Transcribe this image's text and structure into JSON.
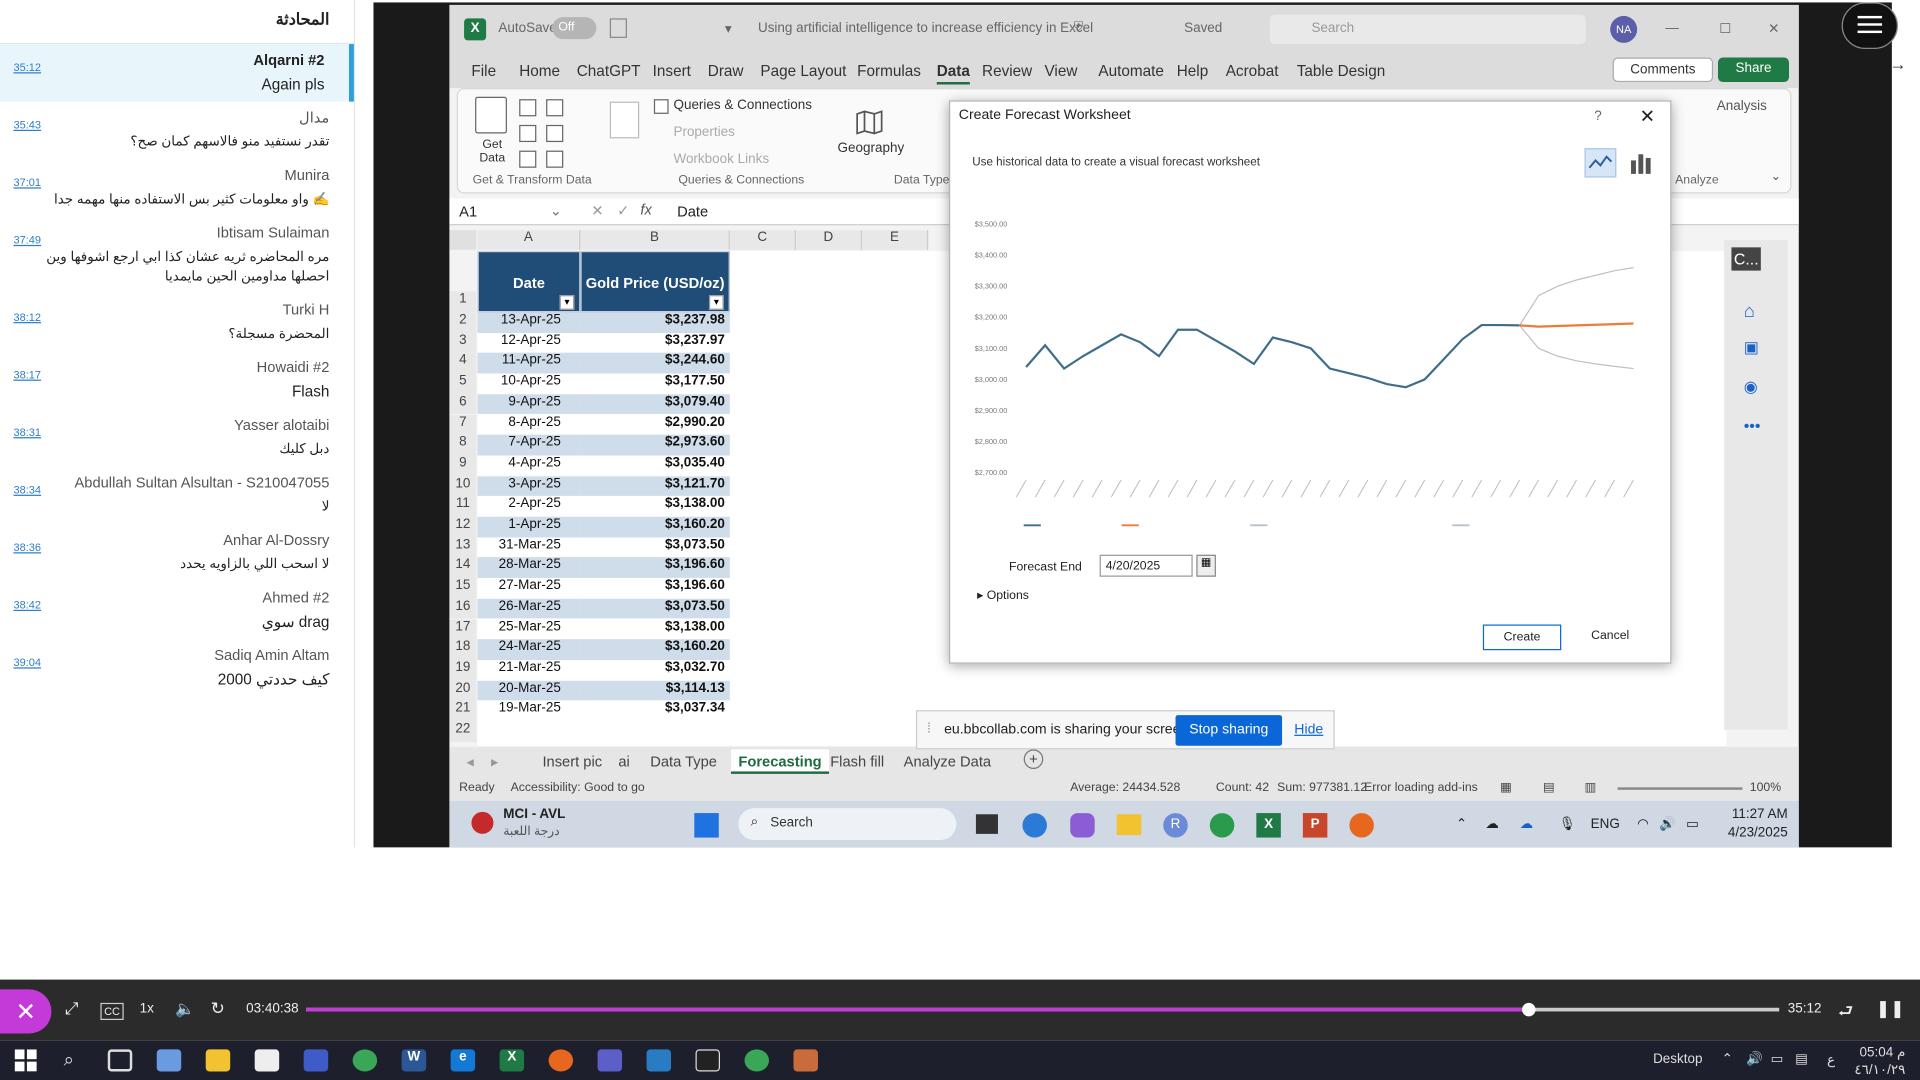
{
  "chat": {
    "title": "المحادثة",
    "messages": [
      {
        "time": "35:12",
        "name": "Alqarni #2",
        "text": "Again pls"
      },
      {
        "time": "35:43",
        "name": "مدال",
        "text": "تقدر نستفيد منو فالاسهم كمان صح؟"
      },
      {
        "time": "37:01",
        "name": "Munira",
        "text": "واو معلومات كثير بس الاستفاده منها مهمه جدا ✍️"
      },
      {
        "time": "37:49",
        "name": "Ibtisam Sulaiman",
        "text": "مره المحاضره ثريه عشان كذا ابي ارجع اشوفها وين احصلها مداومين الحين مايمديا"
      },
      {
        "time": "38:12",
        "name": "Turki H",
        "text": "المحضرة مسجلة؟"
      },
      {
        "time": "38:17",
        "name": "Howaidi #2",
        "text": "Flash"
      },
      {
        "time": "38:31",
        "name": "Yasser alotaibi",
        "text": "دبل كليك"
      },
      {
        "time": "38:34",
        "name": "Abdullah Sultan Alsultan - S210047055",
        "text": "لا"
      },
      {
        "time": "38:36",
        "name": "Anhar Al-Dossry",
        "text": "لا اسحب اللي بالزاويه يحدد"
      },
      {
        "time": "38:42",
        "name": "Ahmed #2",
        "text": "سوي drag"
      },
      {
        "time": "39:04",
        "name": "Sadiq Amin Altam",
        "text": "كيف حددتي 2000"
      }
    ]
  },
  "excel": {
    "title": "Using artificial intelligence to increase efficiency in Excel",
    "autosave": "AutoSave",
    "toggle": "Off",
    "saved": "Saved",
    "search": "Search",
    "user_initials": "NA",
    "menu": [
      "File",
      "Home",
      "ChatGPT",
      "Insert",
      "Draw",
      "Page Layout",
      "Formulas",
      "Data",
      "Review",
      "View",
      "Automate",
      "Help",
      "Acrobat",
      "Table Design"
    ],
    "comments": "Comments",
    "share": "Share",
    "ribbon": {
      "get_data": "Get Data",
      "queries": "Queries & Connections",
      "properties": "Properties",
      "workbook_links": "Workbook Links",
      "geography": "Geography",
      "analysis": "Analysis",
      "group_get": "Get & Transform Data",
      "group_queries": "Queries & Connections",
      "group_types": "Data Types",
      "group_analyze": "Analyze"
    },
    "name_box": "A1",
    "formula": "Date",
    "columns": [
      "A",
      "B",
      "C",
      "D",
      "E"
    ],
    "header_date": "Date",
    "header_price": "Gold Price (USD/oz)",
    "rows": [
      [
        "13-Apr-25",
        "$3,237.98"
      ],
      [
        "12-Apr-25",
        "$3,237.97"
      ],
      [
        "11-Apr-25",
        "$3,244.60"
      ],
      [
        "10-Apr-25",
        "$3,177.50"
      ],
      [
        "9-Apr-25",
        "$3,079.40"
      ],
      [
        "8-Apr-25",
        "$2,990.20"
      ],
      [
        "7-Apr-25",
        "$2,973.60"
      ],
      [
        "4-Apr-25",
        "$3,035.40"
      ],
      [
        "3-Apr-25",
        "$3,121.70"
      ],
      [
        "2-Apr-25",
        "$3,138.00"
      ],
      [
        "1-Apr-25",
        "$3,160.20"
      ],
      [
        "31-Mar-25",
        "$3,073.50"
      ],
      [
        "28-Mar-25",
        "$3,196.60"
      ],
      [
        "27-Mar-25",
        "$3,196.60"
      ],
      [
        "26-Mar-25",
        "$3,073.50"
      ],
      [
        "25-Mar-25",
        "$3,138.00"
      ],
      [
        "24-Mar-25",
        "$3,160.20"
      ],
      [
        "21-Mar-25",
        "$3,032.70"
      ],
      [
        "20-Mar-25",
        "$3,114.13"
      ],
      [
        "19-Mar-25",
        "$3,037.34"
      ]
    ],
    "sheet_tabs": [
      "Insert pic",
      "ai",
      "Data Type",
      "Forecasting",
      "Flash fill",
      "Analyze Data"
    ],
    "active_tab": "Forecasting",
    "status": {
      "ready": "Ready",
      "accessibility": "Accessibility: Good to go",
      "average": "Average: 24434.528",
      "count": "Count: 42",
      "sum": "Sum: 977381.12",
      "addins": "Error loading add-ins",
      "zoom": "100%"
    },
    "side_pane_title": "C..."
  },
  "dialog": {
    "title": "Create Forecast Worksheet",
    "help": "?",
    "subtitle": "Use historical data to create a visual forecast worksheet",
    "forecast_end_label": "Forecast End",
    "forecast_end_value": "4/20/2025",
    "options": "Options",
    "create": "Create",
    "cancel": "Cancel"
  },
  "chart_data": {
    "type": "line",
    "ylim": [
      2700,
      3500
    ],
    "yticks": [
      "$3,500.00",
      "$3,400.00",
      "$3,300.00",
      "$3,200.00",
      "$3,100.00",
      "$3,000.00",
      "$2,900.00",
      "$2,800.00",
      "$2,700.00"
    ],
    "history": [
      3040,
      3110,
      3035,
      3075,
      3110,
      3145,
      3120,
      3075,
      3160,
      3160,
      3125,
      3090,
      3050,
      3135,
      3120,
      3100,
      3035,
      3020,
      3005,
      2985,
      2975,
      3000,
      3065,
      3130,
      3175,
      3175,
      3174
    ],
    "forecast": [
      3174,
      3170,
      3172,
      3174,
      3176,
      3178,
      3180
    ],
    "upper": [
      3174,
      3270,
      3300,
      3320,
      3335,
      3350,
      3360
    ],
    "lower": [
      3174,
      3100,
      3075,
      3060,
      3050,
      3042,
      3035
    ],
    "series_colors": {
      "history": "#3f6d8a",
      "forecast": "#ef7b39",
      "bounds": "#b9c1c9"
    }
  },
  "share_bar": {
    "text": "eu.bbcollab.com is sharing your screen.",
    "stop": "Stop sharing",
    "hide": "Hide"
  },
  "win_inner": {
    "weather_title": "MCI - AVL",
    "weather_sub": "درجة اللعبة",
    "search": "Search",
    "lang": "ENG",
    "time": "11:27 AM",
    "date": "4/23/2025"
  },
  "player": {
    "speed": "1x",
    "elapsed": "03:40:38",
    "remaining": "35:12",
    "progress": 0.83
  },
  "taskbar": {
    "desktop": "Desktop",
    "lang": "ع",
    "time": "05:04 م",
    "date": "٤٦/١٠/٢٩"
  }
}
